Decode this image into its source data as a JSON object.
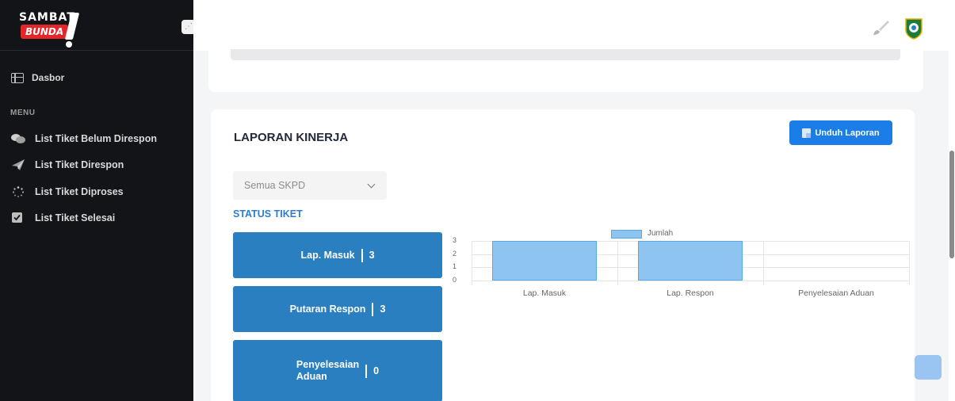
{
  "sidebar": {
    "logo": {
      "line1": "SAMBAT",
      "line2": "BUNDA"
    },
    "dashboard_label": "Dasbor",
    "menu_label": "MENU",
    "items": [
      {
        "label": "List Tiket Belum Direspon",
        "icon": "chat-bubbles-icon"
      },
      {
        "label": "List Tiket Direspon",
        "icon": "paper-plane-icon"
      },
      {
        "label": "List Tiket Diproses",
        "icon": "spinner-icon"
      },
      {
        "label": "List Tiket Selesai",
        "icon": "check-square-icon"
      }
    ]
  },
  "topbar": {
    "icons": [
      "brush-icon",
      "emblem-icon"
    ]
  },
  "report": {
    "title": "LAPORAN KINERJA",
    "download_label": "Unduh Laporan",
    "skpd_select": "Semua SKPD",
    "status_title": "STATUS TIKET",
    "stats": [
      {
        "label": "Lap. Masuk",
        "value": "3"
      },
      {
        "label": "Putaran Respon",
        "value": "3"
      },
      {
        "label_line1": "Penyelesaian",
        "label_line2": "Aduan",
        "value": "0"
      }
    ]
  },
  "chart_data": {
    "type": "bar",
    "categories": [
      "Lap. Masuk",
      "Lap. Respon",
      "Penyelesaian Aduan"
    ],
    "series": [
      {
        "name": "Jumlah",
        "values": [
          3,
          3,
          0
        ],
        "color": "#8ec5f0"
      }
    ],
    "y_ticks": [
      "3",
      "2",
      "1",
      "0"
    ],
    "ylim": [
      0,
      3
    ],
    "legend": "top-center",
    "grid": true
  },
  "colors": {
    "sidebar_bg": "#121417",
    "accent": "#1b7ee8",
    "stat_bg": "#2a7fc0",
    "status_title": "#2d7dd2"
  }
}
